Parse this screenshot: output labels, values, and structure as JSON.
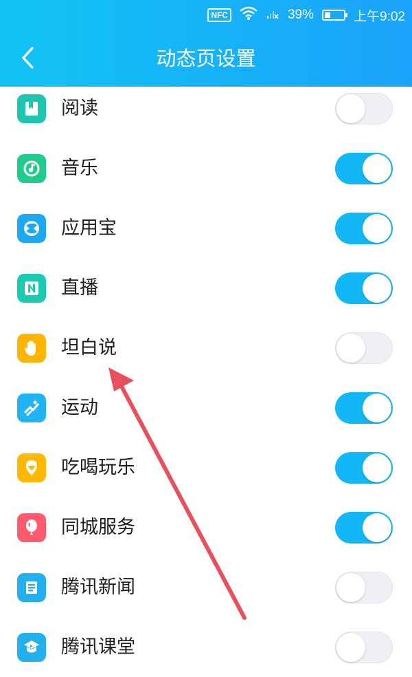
{
  "status_bar": {
    "nfc": "NFC",
    "battery_percent": "39%",
    "battery_level": 0.39,
    "time": "上午9:02",
    "icons": [
      "wifi-icon",
      "no-signal-icon",
      "battery-icon"
    ]
  },
  "header": {
    "title": "动态页设置",
    "back_icon": "chevron-left-icon"
  },
  "colors": {
    "header_start": "#12c4f4",
    "header_end": "#1aa3fb",
    "toggle_on": "#12b7f5",
    "toggle_off": "#eef0f4",
    "annotation_arrow": "#e8505d"
  },
  "items": [
    {
      "label": "阅读",
      "enabled": false,
      "icon": "book-icon",
      "color": "#1ec6b0"
    },
    {
      "label": "音乐",
      "enabled": true,
      "icon": "music-icon",
      "color": "#1fcc8c"
    },
    {
      "label": "应用宝",
      "enabled": true,
      "icon": "app-store-icon",
      "color": "#1da8f2"
    },
    {
      "label": "直播",
      "enabled": true,
      "icon": "live-icon",
      "color": "#19cbb2"
    },
    {
      "label": "坦白说",
      "enabled": false,
      "icon": "hand-icon",
      "color": "#ffb400"
    },
    {
      "label": "运动",
      "enabled": true,
      "icon": "running-icon",
      "color": "#21b4f2"
    },
    {
      "label": "吃喝玩乐",
      "enabled": true,
      "icon": "food-icon",
      "color": "#ffb800"
    },
    {
      "label": "同城服务",
      "enabled": true,
      "icon": "balloon-icon",
      "color": "#ff5a6e"
    },
    {
      "label": "腾讯新闻",
      "enabled": false,
      "icon": "news-icon",
      "color": "#22b0ef"
    },
    {
      "label": "腾讯课堂",
      "enabled": false,
      "icon": "classroom-icon",
      "color": "#22b0ef"
    }
  ]
}
